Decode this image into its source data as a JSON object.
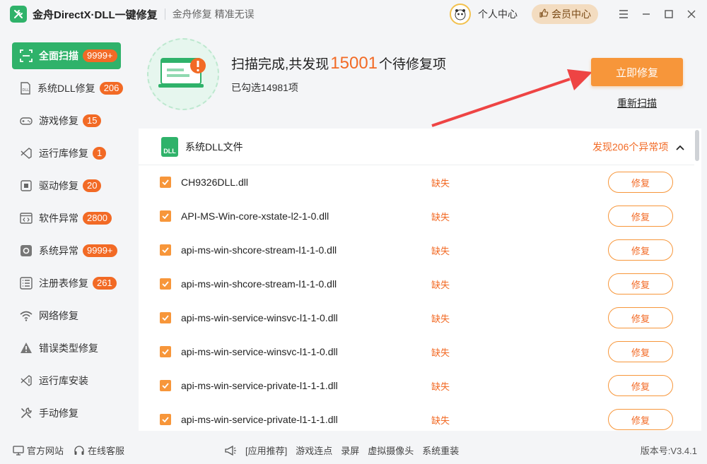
{
  "titlebar": {
    "title": "金舟DirectX·DLL一键修复",
    "slogan": "金舟修复 精准无误",
    "user_center": "个人中心",
    "vip_center": "会员中心"
  },
  "sidebar": {
    "items": [
      {
        "label": "全面扫描",
        "badge": "9999+",
        "icon": "scan-icon"
      },
      {
        "label": "系统DLL修复",
        "badge": "206",
        "icon": "dll-icon"
      },
      {
        "label": "游戏修复",
        "badge": "15",
        "icon": "gamepad-icon"
      },
      {
        "label": "运行库修复",
        "badge": "1",
        "icon": "runtime-icon"
      },
      {
        "label": "驱动修复",
        "badge": "20",
        "icon": "driver-icon"
      },
      {
        "label": "软件异常",
        "badge": "2800",
        "icon": "code-window-icon"
      },
      {
        "label": "系统异常",
        "badge": "9999+",
        "icon": "gear-icon"
      },
      {
        "label": "注册表修复",
        "badge": "261",
        "icon": "list-icon"
      },
      {
        "label": "网络修复",
        "badge": "",
        "icon": "wifi-icon"
      },
      {
        "label": "错误类型修复",
        "badge": "",
        "icon": "warning-icon"
      },
      {
        "label": "运行库安装",
        "badge": "",
        "icon": "install-icon"
      },
      {
        "label": "手动修复",
        "badge": "",
        "icon": "wrench-icon"
      }
    ]
  },
  "summary": {
    "title_prefix": "扫描完成,共发现",
    "count": "15001",
    "title_suffix": "个待修复项",
    "selected": "已勾选14981项",
    "fix_now": "立即修复",
    "rescan": "重新扫描"
  },
  "section": {
    "badge": "DLL",
    "title": "系统DLL文件",
    "found": "发现206个异常项"
  },
  "rows": [
    {
      "file": "CH9326DLL.dll",
      "status": "缺失",
      "action": "修复"
    },
    {
      "file": "API-MS-Win-core-xstate-l2-1-0.dll",
      "status": "缺失",
      "action": "修复"
    },
    {
      "file": "api-ms-win-shcore-stream-l1-1-0.dll",
      "status": "缺失",
      "action": "修复"
    },
    {
      "file": "api-ms-win-shcore-stream-l1-1-0.dll",
      "status": "缺失",
      "action": "修复"
    },
    {
      "file": "api-ms-win-service-winsvc-l1-1-0.dll",
      "status": "缺失",
      "action": "修复"
    },
    {
      "file": "api-ms-win-service-winsvc-l1-1-0.dll",
      "status": "缺失",
      "action": "修复"
    },
    {
      "file": "api-ms-win-service-private-l1-1-1.dll",
      "status": "缺失",
      "action": "修复"
    },
    {
      "file": "api-ms-win-service-private-l1-1-1.dll",
      "status": "缺失",
      "action": "修复"
    }
  ],
  "footer": {
    "website": "官方网站",
    "support": "在线客服",
    "recommend": "[应用推荐]",
    "links": [
      "游戏连点",
      "录屏",
      "虚拟摄像头",
      "系统重装"
    ],
    "version": "版本号:V3.4.1"
  },
  "colors": {
    "accent_green": "#2fb26a",
    "accent_orange": "#f7963a",
    "alert_orange": "#f26a25"
  }
}
